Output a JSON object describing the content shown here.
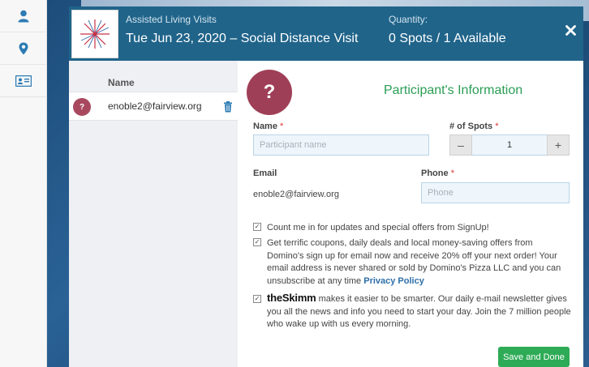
{
  "rail": {
    "items": [
      {
        "icon": "person-icon"
      },
      {
        "icon": "map-pin-icon"
      },
      {
        "icon": "contact-card-icon"
      }
    ]
  },
  "header": {
    "event_label": "Assisted Living Visits",
    "event_title": "Tue Jun 23, 2020 – Social Distance Visit",
    "quantity_label": "Quantity:",
    "quantity_value": "0 Spots / 1 Available",
    "close_icon": "close-icon"
  },
  "participants": {
    "column_header": "Name",
    "rows": [
      {
        "avatar": "?",
        "email": "enoble2@fairview.org",
        "icon": "trash-icon"
      }
    ]
  },
  "form": {
    "avatar": "?",
    "title": "Participant's Information",
    "name_label": "Name",
    "required_mark": "*",
    "name_placeholder": "Participant name",
    "spots_label": "# of Spots",
    "spots_value": "1",
    "minus": "–",
    "plus": "+",
    "email_label": "Email",
    "email_value": "enoble2@fairview.org",
    "phone_label": "Phone",
    "phone_placeholder": "Phone",
    "optin_1": "Count me in for updates and special offers from SignUp!",
    "optin_2": "Get terrific coupons, daily deals and local money-saving offers from Domino's sign up for email now and receive 20% off your next order! Your email address is never shared or sold by Domino's Pizza LLC and you can unsubscribe at any time",
    "optin_2_link": "Privacy Policy",
    "optin_3_brand": "theSkimm",
    "optin_3": "makes it easier to be smarter. Our daily e-mail newsletter gives you all the news and info you need to start your day. Join the 7 million people who wake up with us every morning.",
    "check_glyph": "✓",
    "save_label": "Save and Done"
  },
  "colors": {
    "header_bg": "#20648a",
    "accent_green": "#2eab56",
    "avatar": "#9f3f57",
    "link": "#2d6fa8"
  }
}
